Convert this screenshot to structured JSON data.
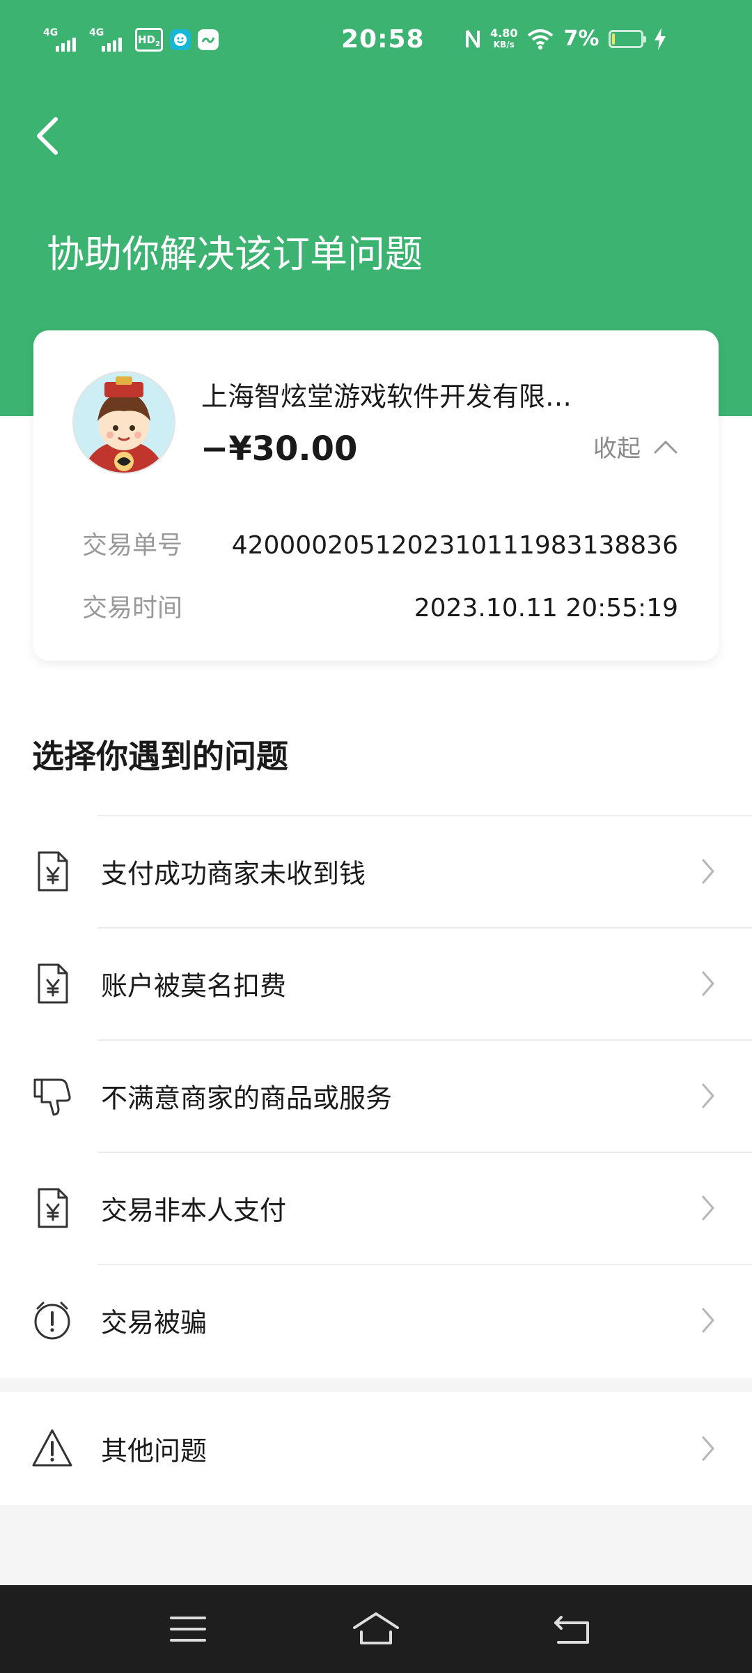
{
  "status_bar": {
    "time": "20:58",
    "signal_1": "4G",
    "signal_2": "4G",
    "hd": "HD",
    "hd_sub": "2",
    "net_speed_value": "4.80",
    "net_speed_unit": "KB/s",
    "battery_percent": "7%",
    "battery_level": 0.07,
    "icons": [
      "signal-icon",
      "signal-icon",
      "hd-icon",
      "app-notification-icon",
      "app-notification-icon",
      "nfc-icon",
      "wifi-icon",
      "battery-icon",
      "charging-icon"
    ]
  },
  "header": {
    "back_icon": "chevron-left-icon",
    "title": "协助你解决该订单问题"
  },
  "order_card": {
    "merchant_name": "上海智炫堂游戏软件开发有限…",
    "amount": "−¥30.00",
    "collapse_label": "收起",
    "collapse_icon": "chevron-up-icon",
    "transaction_no_label": "交易单号",
    "transaction_no": "4200002051202310111983138836",
    "transaction_time_label": "交易时间",
    "transaction_time": "2023.10.11 20:55:19"
  },
  "issues": {
    "title": "选择你遇到的问题",
    "items": [
      {
        "label": "支付成功商家未收到钱",
        "icon": "yuan-document-icon"
      },
      {
        "label": "账户被莫名扣费",
        "icon": "yuan-document-icon"
      },
      {
        "label": "不满意商家的商品或服务",
        "icon": "thumbs-down-icon"
      },
      {
        "label": "交易非本人支付",
        "icon": "yuan-document-icon"
      },
      {
        "label": "交易被骗",
        "icon": "alert-clock-icon"
      }
    ],
    "other": {
      "label": "其他问题",
      "icon": "warning-triangle-icon"
    }
  },
  "colors": {
    "brand_green": "#3cb371",
    "text_primary": "#1a1a1a",
    "text_secondary": "#999999",
    "nav_bar": "#1e1e1e"
  },
  "nav_bar": {
    "icons": [
      "menu-icon",
      "home-icon",
      "back-icon"
    ]
  }
}
